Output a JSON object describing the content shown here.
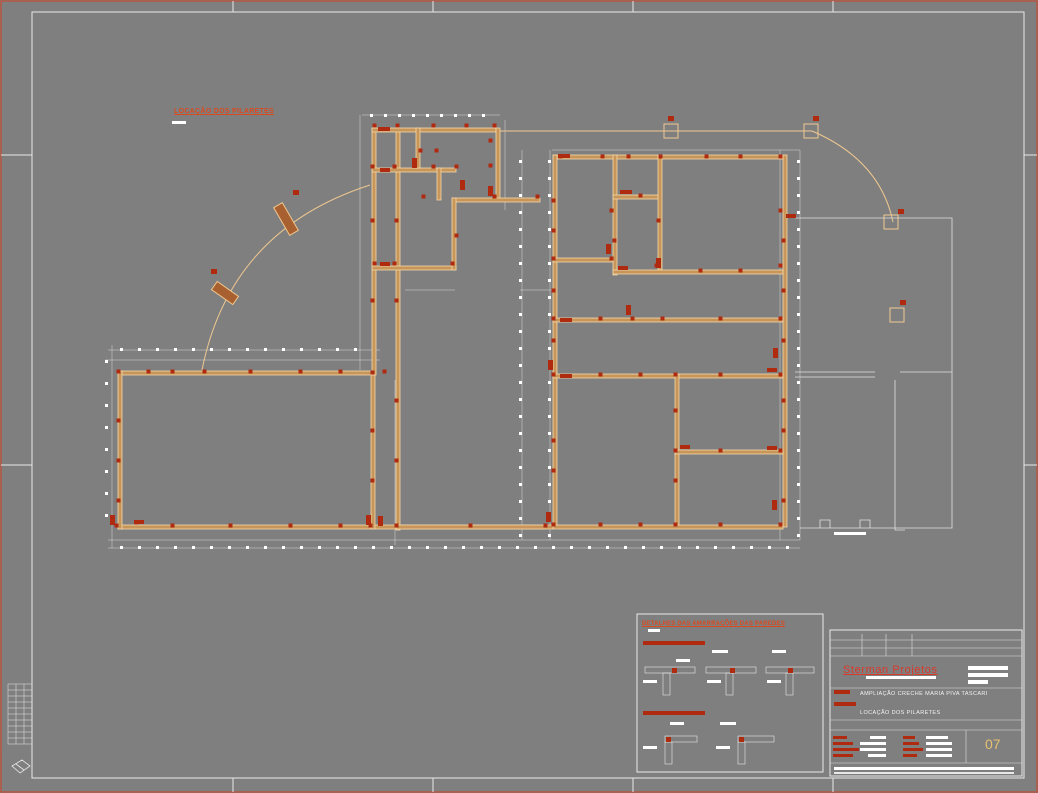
{
  "drawing": {
    "view_title": "LOCAÇÃO DOS PILARETES",
    "detail_title": "DETALHES DAS AMARRAÇÕES DAS PAREDES"
  },
  "title_block": {
    "company": "Sterman Projetos",
    "project": "AMPLIAÇÃO CRECHE MARIA PIVA TASCARI",
    "drawing": "LOCAÇÃO DOS PILARETES",
    "sheet": "07"
  },
  "colors": {
    "background": "#7f7f7f",
    "wall": "#f5d9a8",
    "wall_fill": "#e0b070",
    "column": "#b02a10",
    "frame": "#d04020",
    "text_red": "#d93a2a",
    "grid_line": "#d8d8d8"
  }
}
